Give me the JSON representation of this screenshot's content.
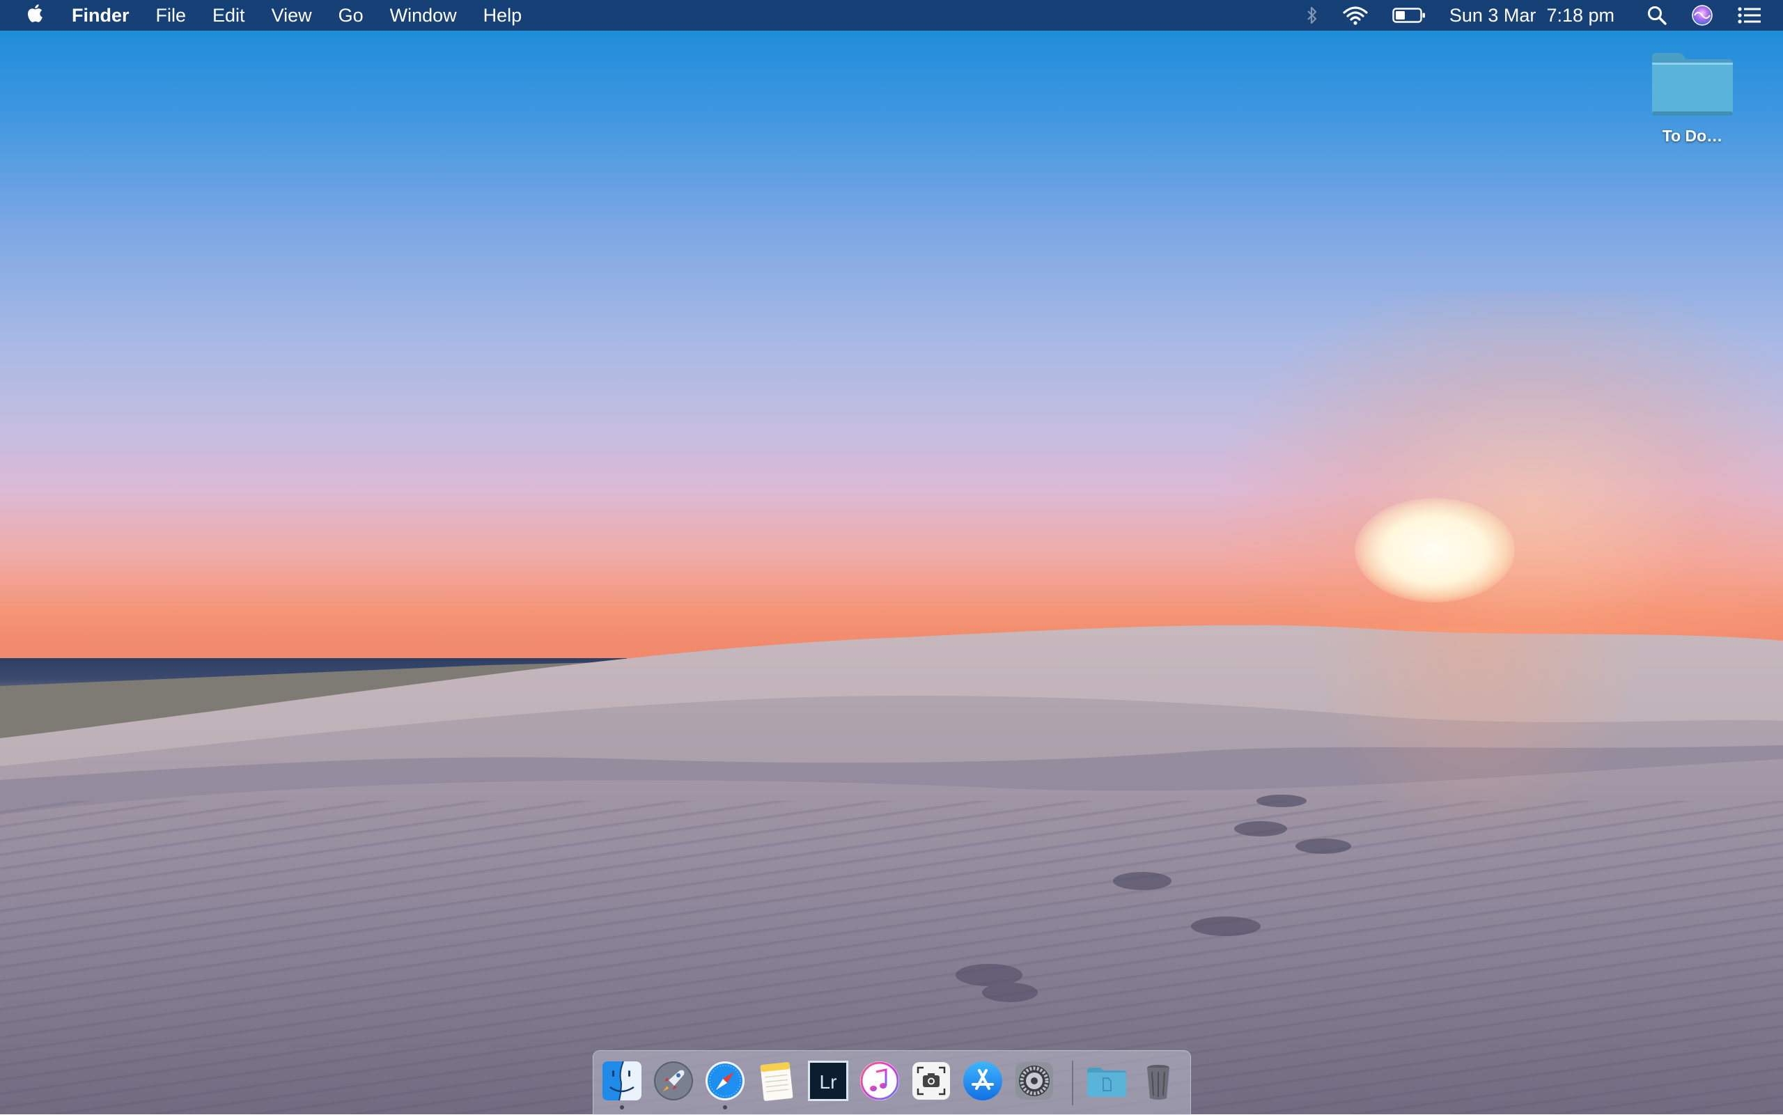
{
  "menubar": {
    "apple_icon": "apple-logo-icon",
    "app_name": "Finder",
    "menus": [
      "File",
      "Edit",
      "View",
      "Go",
      "Window",
      "Help"
    ],
    "status_icons": [
      "bluetooth-icon",
      "wifi-icon",
      "battery-icon"
    ],
    "date": "Sun 3 Mar",
    "time": "7:18 pm",
    "right_icons": [
      "spotlight-search-icon",
      "siri-icon",
      "notification-center-icon"
    ]
  },
  "desktop": {
    "items": [
      {
        "label": "To Do…",
        "icon": "folder-icon"
      }
    ]
  },
  "dock": {
    "apps": [
      {
        "name": "Finder",
        "icon": "finder-icon",
        "running": true
      },
      {
        "name": "Launchpad",
        "icon": "launchpad-icon",
        "running": false
      },
      {
        "name": "Safari",
        "icon": "safari-icon",
        "running": true
      },
      {
        "name": "Notes",
        "icon": "notes-icon",
        "running": false
      },
      {
        "name": "Lightroom",
        "icon": "lightroom-icon",
        "text": "Lr",
        "running": false
      },
      {
        "name": "iTunes",
        "icon": "itunes-icon",
        "running": false
      },
      {
        "name": "Screenshot",
        "icon": "screenshot-icon",
        "running": false
      },
      {
        "name": "App Store",
        "icon": "app-store-icon",
        "running": false
      },
      {
        "name": "System Preferences",
        "icon": "system-preferences-icon",
        "running": false
      }
    ],
    "right": [
      {
        "name": "Documents",
        "icon": "documents-folder-icon"
      },
      {
        "name": "Trash",
        "icon": "trash-icon"
      }
    ]
  },
  "colors": {
    "menubar_bg": "#163a6e",
    "folder_blue": "#56b0d8",
    "sky_top": "#1489d6",
    "sunset_orange": "#f18a6c"
  }
}
